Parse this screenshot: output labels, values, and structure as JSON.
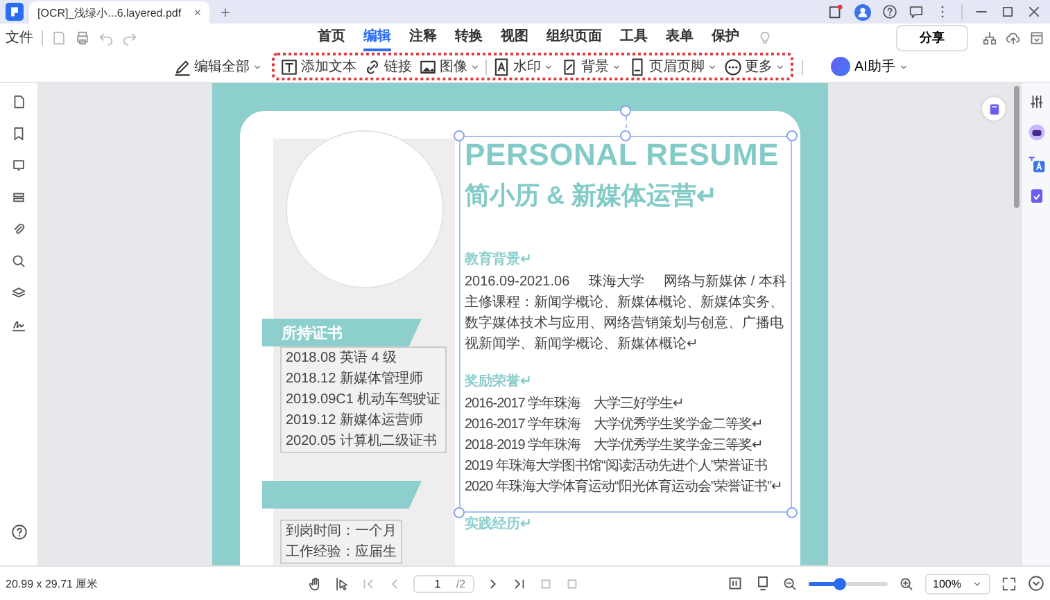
{
  "window": {
    "tab_title": "[OCR]_浅绿小...6.layered.pdf",
    "tab_close": "×",
    "new_tab": "+"
  },
  "menu": {
    "file": "文件",
    "share": "分享",
    "tabs": [
      {
        "label": "首页",
        "selected": false
      },
      {
        "label": "编辑",
        "selected": true
      },
      {
        "label": "注释",
        "selected": false
      },
      {
        "label": "转换",
        "selected": false
      },
      {
        "label": "视图",
        "selected": false
      },
      {
        "label": "组织页面",
        "selected": false
      },
      {
        "label": "工具",
        "selected": false
      },
      {
        "label": "表单",
        "selected": false
      },
      {
        "label": "保护",
        "selected": false
      }
    ]
  },
  "toolbar": {
    "edit_all": "编辑全部",
    "ai": "AI助手",
    "tools": [
      {
        "label": "添加文本",
        "kind": "text",
        "dropdown": false
      },
      {
        "label": "链接",
        "kind": "link",
        "dropdown": false
      },
      {
        "label": "图像",
        "kind": "image",
        "dropdown": true
      },
      {
        "label": "水印",
        "kind": "watermark",
        "dropdown": true
      },
      {
        "label": "背景",
        "kind": "background",
        "dropdown": true
      },
      {
        "label": "页眉页脚",
        "kind": "header",
        "dropdown": true
      },
      {
        "label": "更多",
        "kind": "more",
        "dropdown": true
      }
    ]
  },
  "resume": {
    "title": "PERSONAL RESUME",
    "subtitle": "简小历 & 新媒体运营↵",
    "certificates": {
      "heading": "所持证书",
      "items": [
        "2018.08 英语 4 级",
        "2018.12 新媒体管理师",
        "2019.09C1 机动车驾驶证",
        "2019.12 新媒体运营师",
        "2020.05 计算机二级证书"
      ]
    },
    "job_items": [
      "到岗时间：一个月",
      "工作经验：应届生"
    ],
    "sections": [
      {
        "heading": "教育背景↵",
        "kind": "education",
        "columns": [
          "2016.09-2021.06",
          "珠海大学",
          "网络与新媒体 / 本科"
        ],
        "lines": [
          "主修课程：新闻学概论、新媒体概论、新媒体实务、数字媒体技术与应用、网络营销策划与创意、广播电视新闻学、新闻学概论、新媒体概论↵"
        ]
      },
      {
        "heading": "奖励荣誉↵",
        "kind": "list",
        "lines": [
          "2016-2017 学年珠海　大学三好学生↵",
          "2016-2017 学年珠海　大学优秀学生奖学金二等奖↵",
          "2018-2019 学年珠海　大学优秀学生奖学金三等奖↵",
          "2019 年珠海大学图书馆“阅读活动先进个人”荣誉证书",
          "2020 年珠海大学体育运动“阳光体育运动会”荣誉证书”↵"
        ]
      },
      {
        "heading": "实践经历↵",
        "kind": "list"
      }
    ]
  },
  "status_bar": {
    "dimensions": "20.99 x 29.71 厘米",
    "page": "1",
    "page_total": "/2",
    "zoom": "100%",
    "zoom_slider": {
      "level": 0.4
    }
  }
}
